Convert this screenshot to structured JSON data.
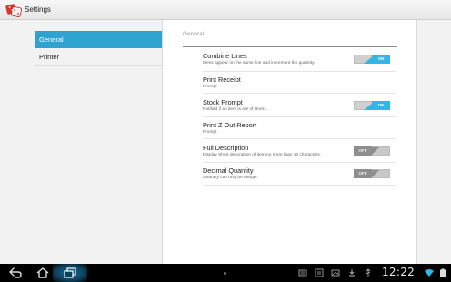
{
  "app": {
    "title": "Settings",
    "icon": "dice-icon"
  },
  "nav": {
    "items": [
      {
        "label": "General",
        "active": true
      },
      {
        "label": "Printer",
        "active": false
      }
    ]
  },
  "section": {
    "header": "General"
  },
  "preferences": [
    {
      "title": "Combine Lines",
      "summary": "Items appear on the same line and increment the quantity.",
      "toggle": "ON"
    },
    {
      "title": "Print Receipt",
      "summary": "Prompt",
      "toggle": null
    },
    {
      "title": "Stock Prompt",
      "summary": "Notified if an item is out of stock.",
      "toggle": "ON"
    },
    {
      "title": "Print Z Out Report",
      "summary": "Prompt",
      "toggle": null
    },
    {
      "title": "Full Description",
      "summary": "Display Short description of item no more than 12 characters.",
      "toggle": "OFF"
    },
    {
      "title": "Decimal Quantity",
      "summary": "Quantity can only be Integer.",
      "toggle": "OFF"
    }
  ],
  "status_bar": {
    "time": "12:22"
  },
  "colors": {
    "accent": "#33b5e5",
    "nav_active": "#2fa3d0"
  }
}
